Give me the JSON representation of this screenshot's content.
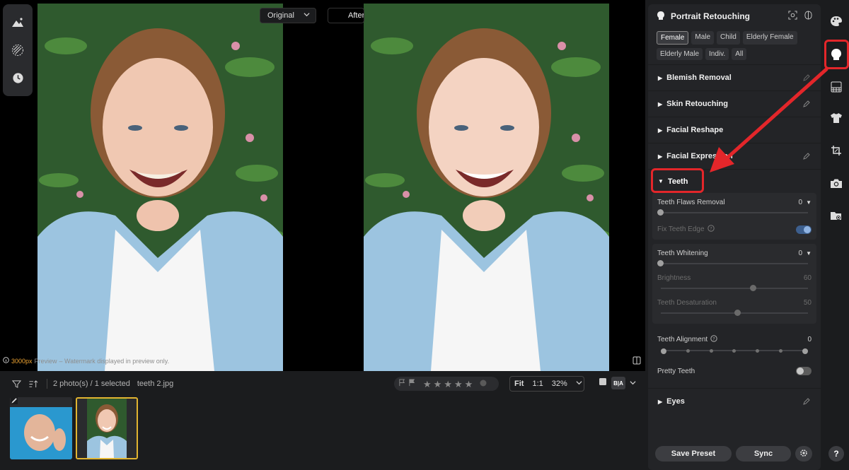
{
  "canvas": {
    "view_mode": "Original",
    "after_label": "After",
    "preview_resolution": "3000px",
    "preview_word": "Preview",
    "preview_note": "– Watermark displayed in preview only."
  },
  "filmstrip": {
    "photo_count": "2 photo(s) / 1 selected",
    "filename": "teeth 2.jpg",
    "zoom_fit": "Fit",
    "zoom_one": "1:1",
    "zoom_percent": "32%",
    "ba_label": "B|A"
  },
  "panel": {
    "title": "Portrait Retouching",
    "chips": [
      "Female",
      "Male",
      "Child",
      "Elderly Female",
      "Elderly Male",
      "Indiv.",
      "All"
    ],
    "active_chip": "Female",
    "sections_top": [
      "Blemish Removal",
      "Skin Retouching",
      "Facial Reshape",
      "Facial Expression"
    ],
    "teeth": {
      "title": "Teeth",
      "flaws_label": "Teeth Flaws Removal",
      "flaws_value": "0",
      "fix_edge_label": "Fix Teeth Edge",
      "whitening_label": "Teeth Whitening",
      "whitening_value": "0",
      "brightness_label": "Brightness",
      "brightness_value": "60",
      "desaturation_label": "Teeth Desaturation",
      "desaturation_value": "50",
      "alignment_label": "Teeth Alignment",
      "alignment_value": "0",
      "pretty_label": "Pretty Teeth"
    },
    "sections_bottom": [
      "Eyes"
    ],
    "save_preset": "Save Preset",
    "sync": "Sync"
  },
  "rail": {
    "help": "?"
  }
}
